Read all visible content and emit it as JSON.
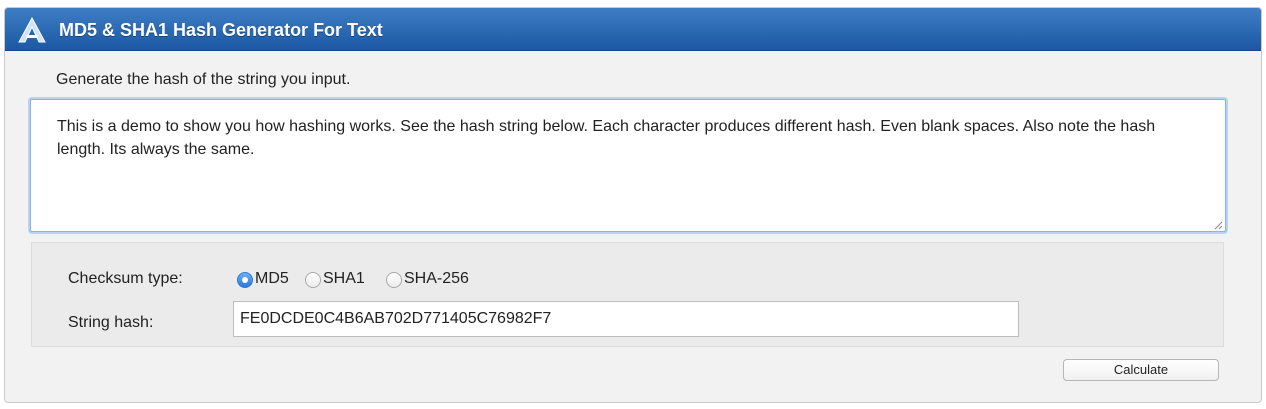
{
  "app": {
    "title": "MD5 & SHA1 Hash Generator For Text",
    "logo_icon": "a-logo-icon"
  },
  "form": {
    "intro": "Generate the hash of the string you input.",
    "input_text": "This is a demo to show you how hashing works. See the hash string below. Each character produces different hash. Even blank spaces. Also note the hash length. Its always the same.",
    "checksum_label": "Checksum type:",
    "checksum_options": [
      {
        "label": "MD5",
        "selected": true
      },
      {
        "label": "SHA1",
        "selected": false
      },
      {
        "label": "SHA-256",
        "selected": false
      }
    ],
    "hash_label": "String hash:",
    "hash_value": "FE0DCDE0C4B6AB702D771405C76982F7",
    "calculate_label": "Calculate"
  },
  "colors": {
    "titlebar_top": "#3e7dc4",
    "titlebar_bottom": "#1c58a4",
    "radio_selected": "#2a78dc",
    "focus_ring": "#b9d2f3"
  }
}
